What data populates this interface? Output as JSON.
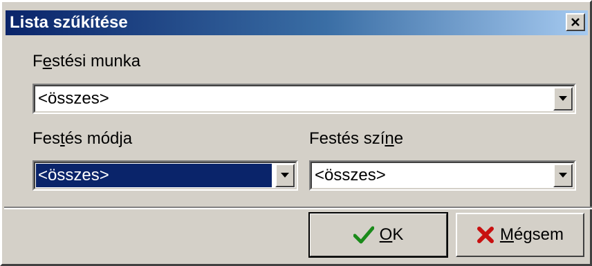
{
  "dialog": {
    "title": "Lista szűkítése",
    "close_label": "×"
  },
  "fields": {
    "work": {
      "label_first": "F",
      "label_underlined": "e",
      "label_rest": "stési munka",
      "value": "<összes>"
    },
    "mode": {
      "label_first": "Fes",
      "label_underlined": "t",
      "label_rest": "és módja",
      "value": "<összes>"
    },
    "color": {
      "label_first": "Festés szí",
      "label_underlined": "n",
      "label_rest": "e",
      "value": "<összes>"
    }
  },
  "buttons": {
    "ok": {
      "label_underlined": "O",
      "label_rest": "K",
      "icon": "check-icon",
      "icon_color": "#1a8a1a"
    },
    "cancel": {
      "label_underlined": "M",
      "label_rest": "égsem",
      "icon": "x-icon",
      "icon_color": "#c81010"
    }
  },
  "colors": {
    "titlebar_start": "#0a246a",
    "titlebar_end": "#a6caf0",
    "face": "#d4d0c8",
    "selection": "#0a246a"
  }
}
